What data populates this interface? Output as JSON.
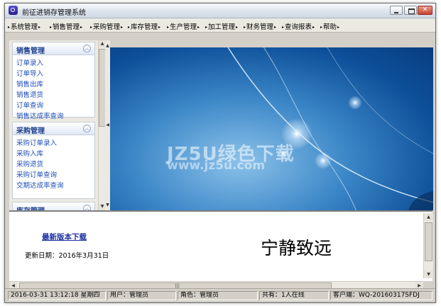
{
  "window": {
    "title": "前征进销存管理系统"
  },
  "menu": [
    {
      "label": "系统管理"
    },
    {
      "label": "销售管理"
    },
    {
      "label": "采购管理"
    },
    {
      "label": "库存管理"
    },
    {
      "label": "生产管理"
    },
    {
      "label": "加工管理"
    },
    {
      "label": "财务管理"
    },
    {
      "label": "查询报表"
    },
    {
      "label": "帮助"
    }
  ],
  "sidebar": {
    "sections": [
      {
        "title": "销售管理",
        "items": [
          "订单录入",
          "订单导入",
          "销售出库",
          "销售退货",
          "订单查询",
          "销售达成率查询"
        ]
      },
      {
        "title": "采购管理",
        "items": [
          "采购订单录入",
          "采购入库",
          "采购退货",
          "采购订单查询",
          "交期达成率查询"
        ]
      },
      {
        "title": "库存管理",
        "items": []
      }
    ]
  },
  "banner": {
    "watermark_main": "JZ5U绿色下载",
    "watermark_sub": "www.jz5u.com"
  },
  "info": {
    "download_link": "最新版本下载",
    "update_date": "更新日期：2016年3月31日",
    "motto": "宁静致远"
  },
  "status": {
    "datetime": "2016-03-31   13:12:18  星期四",
    "user": "用户：管理员",
    "role": "角色：管理员",
    "online": "共有：1人在线",
    "client": "客户端：WQ-20160317SFDJ"
  },
  "icons": [
    "app-icon",
    "minimize-icon",
    "maximize-icon",
    "close-icon",
    "collapse-icon",
    "scroll-arrow-icon"
  ]
}
